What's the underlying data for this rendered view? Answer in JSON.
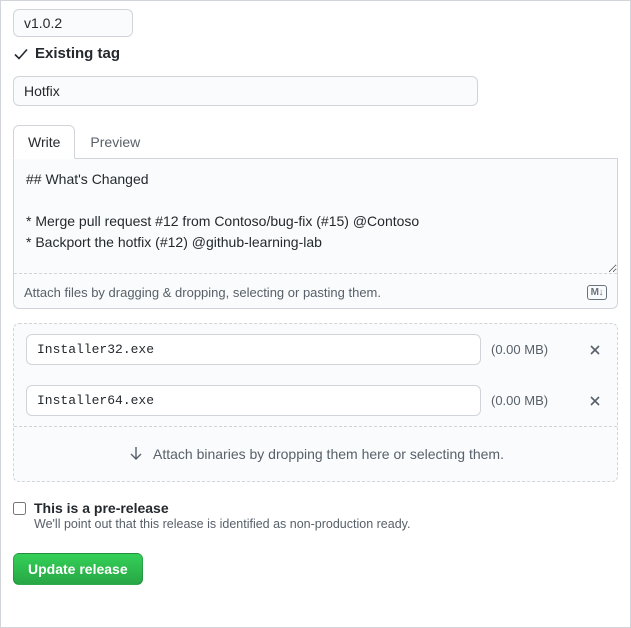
{
  "tag": {
    "value": "v1.0.2",
    "status": "Existing tag"
  },
  "title": {
    "value": "Hotfix"
  },
  "tabs": {
    "write": "Write",
    "preview": "Preview"
  },
  "description": {
    "value": "## What's Changed\n\n* Merge pull request #12 from Contoso/bug-fix (#15) @Contoso\n* Backport the hotfix (#12) @github-learning-lab",
    "attach_hint": "Attach files by dragging & dropping, selecting or pasting them.",
    "md_badge": "M↓"
  },
  "binaries": [
    {
      "name": "Installer32.exe",
      "size": "(0.00 MB)"
    },
    {
      "name": "Installer64.exe",
      "size": "(0.00 MB)"
    }
  ],
  "binaries_drop_hint": "Attach binaries by dropping them here or selecting them.",
  "prerelease": {
    "label": "This is a pre-release",
    "desc": "We'll point out that this release is identified as non-production ready."
  },
  "submit": {
    "label": "Update release"
  }
}
